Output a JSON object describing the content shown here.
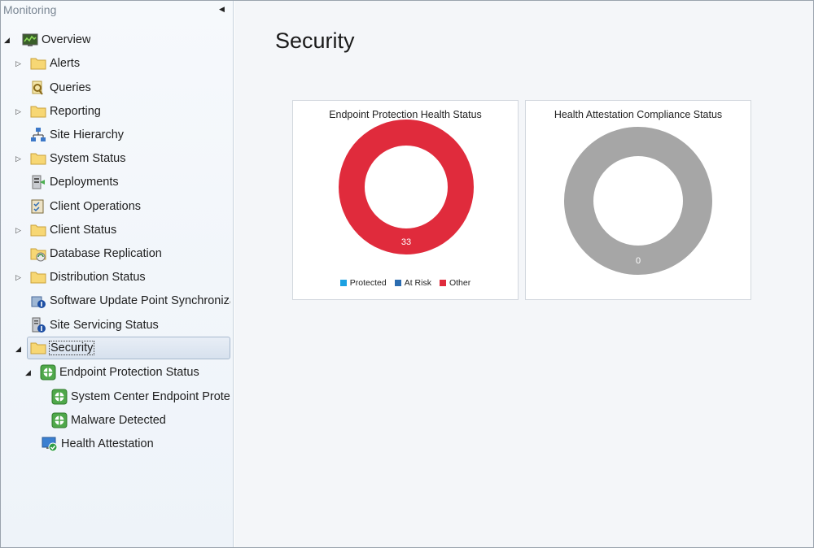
{
  "sidebar": {
    "title": "Monitoring",
    "items": [
      {
        "label": "Overview",
        "icon": "overview-icon"
      },
      {
        "label": "Alerts",
        "icon": "folder-icon"
      },
      {
        "label": "Queries",
        "icon": "queries-icon"
      },
      {
        "label": "Reporting",
        "icon": "folder-icon"
      },
      {
        "label": "Site Hierarchy",
        "icon": "site-hierarchy-icon"
      },
      {
        "label": "System Status",
        "icon": "folder-icon"
      },
      {
        "label": "Deployments",
        "icon": "deployments-icon"
      },
      {
        "label": "Client Operations",
        "icon": "client-operations-icon"
      },
      {
        "label": "Client Status",
        "icon": "folder-icon"
      },
      {
        "label": "Database Replication",
        "icon": "database-replication-icon"
      },
      {
        "label": "Distribution Status",
        "icon": "folder-icon"
      },
      {
        "label": "Software Update Point Synchronization Status",
        "icon": "sup-sync-icon"
      },
      {
        "label": "Site Servicing Status",
        "icon": "site-servicing-icon"
      },
      {
        "label": "Security",
        "icon": "folder-icon"
      },
      {
        "label": "Endpoint Protection Status",
        "icon": "endpoint-protection-icon"
      },
      {
        "label": "System Center Endpoint Protection Status",
        "icon": "endpoint-protection-icon"
      },
      {
        "label": "Malware Detected",
        "icon": "endpoint-protection-icon"
      },
      {
        "label": "Health Attestation",
        "icon": "health-attestation-icon"
      }
    ]
  },
  "main": {
    "title": "Security",
    "cards": [
      {
        "title": "Endpoint Protection Health Status",
        "center_label": "33",
        "legend": [
          {
            "label": "Protected",
            "color": "#1ba1e2"
          },
          {
            "label": "At Risk",
            "color": "#2b6cb0"
          },
          {
            "label": "Other",
            "color": "#e02b3c"
          }
        ]
      },
      {
        "title": "Health Attestation Compliance Status",
        "center_label": "0",
        "legend": []
      }
    ]
  },
  "chart_data": [
    {
      "type": "pie",
      "title": "Endpoint Protection Health Status",
      "categories": [
        "Protected",
        "At Risk",
        "Other"
      ],
      "values": [
        0,
        0,
        33
      ],
      "colors": [
        "#1ba1e2",
        "#2b6cb0",
        "#e02b3c"
      ],
      "legend": "bottom"
    },
    {
      "type": "pie",
      "title": "Health Attestation Compliance Status",
      "categories": [],
      "values": [
        0
      ],
      "colors": [
        "#a6a6a6"
      ],
      "legend": "none"
    }
  ]
}
